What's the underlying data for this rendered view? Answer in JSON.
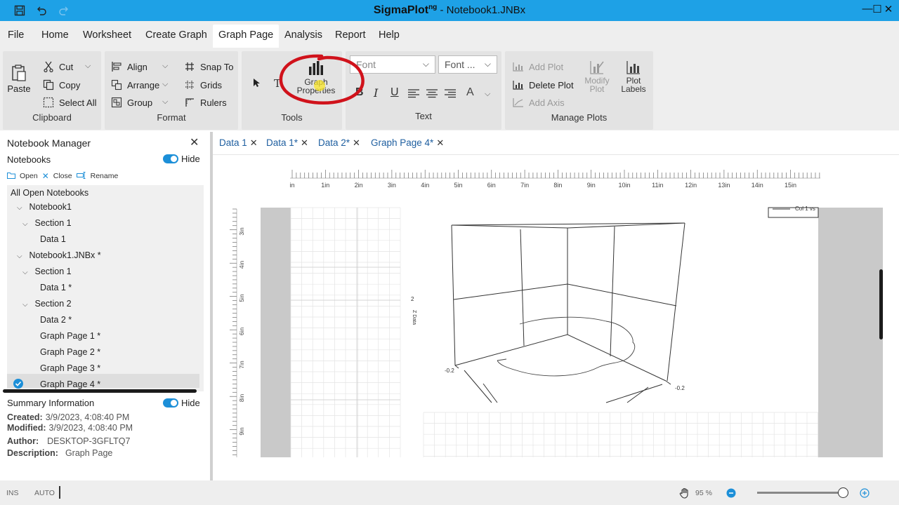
{
  "window": {
    "app_name": "SigmaPlot",
    "app_superscript": "ng",
    "doc_title": " - Notebook1.JNBx",
    "controls": [
      "—",
      "☐",
      "✕"
    ]
  },
  "menu": {
    "items": [
      "File",
      "Home",
      "Worksheet",
      "Create Graph",
      "Graph Page",
      "Analysis",
      "Report",
      "Help"
    ],
    "active": "Graph Page"
  },
  "ribbon": {
    "clipboard": {
      "label": "Clipboard",
      "paste": "Paste",
      "cut": "Cut",
      "copy": "Copy",
      "select_all": "Select All"
    },
    "format": {
      "label": "Format",
      "align": "Align",
      "arrange": "Arrange",
      "group": "Group",
      "snap_to": "Snap To",
      "grids": "Grids",
      "rulers": "Rulers"
    },
    "tools": {
      "label": "Tools",
      "text_tool": "T",
      "graph_properties_line1": "Graph",
      "graph_properties_line2": "Properties"
    },
    "text": {
      "label": "Text",
      "font_placeholder": "Font",
      "font_size_placeholder": "Font ...",
      "bold": "B",
      "italic": "I",
      "underline": "U",
      "color": "A"
    },
    "manage_plots": {
      "label": "Manage Plots",
      "add_plot": "Add Plot",
      "delete_plot": "Delete Plot",
      "add_axis": "Add Axis",
      "modify_plot_line1": "Modify",
      "modify_plot_line2": "Plot",
      "plot_labels_line1": "Plot",
      "plot_labels_line2": "Labels"
    }
  },
  "notebook_manager": {
    "title": "Notebook Manager",
    "notebooks_label": "Notebooks",
    "hide_label": "Hide",
    "tools": {
      "open": "Open",
      "close": "Close",
      "rename": "Rename"
    },
    "tree": [
      {
        "label": "All Open Notebooks",
        "level": 0,
        "twisty": ""
      },
      {
        "label": "Notebook1",
        "level": 1,
        "twisty": "⌵"
      },
      {
        "label": "Section 1",
        "level": 2,
        "twisty": "⌵"
      },
      {
        "label": "Data 1",
        "level": 3,
        "twisty": ""
      },
      {
        "label": "Notebook1.JNBx *",
        "level": 1,
        "twisty": "⌵"
      },
      {
        "label": "Section 1",
        "level": 2,
        "twisty": "⌵"
      },
      {
        "label": "Data 1 *",
        "level": 3,
        "twisty": ""
      },
      {
        "label": "Section 2",
        "level": 2,
        "twisty": "⌵"
      },
      {
        "label": "Data 2 *",
        "level": 3,
        "twisty": ""
      },
      {
        "label": "Graph Page 1 *",
        "level": 3,
        "twisty": ""
      },
      {
        "label": "Graph Page 2 *",
        "level": 3,
        "twisty": ""
      },
      {
        "label": "Graph Page 3 *",
        "level": 3,
        "twisty": ""
      },
      {
        "label": "Graph Page 4 *",
        "level": 3,
        "twisty": ""
      }
    ],
    "selected_index": 12,
    "summary": {
      "title": "Summary Information",
      "hide_label": "Hide",
      "created_label": "Created:",
      "created": "3/9/2023, 4:08:40 PM",
      "modified_label": "Modified:",
      "modified": "3/9/2023, 4:08:40 PM",
      "author_label": "Author:",
      "author": "DESKTOP-3GFLTQ7",
      "description_label": "Description:",
      "description": "Graph Page"
    }
  },
  "doc_tabs": {
    "tabs": [
      "Data 1",
      "Data 1*",
      "Data 2*",
      "Graph Page 4*"
    ],
    "active_index": 3
  },
  "graph_page": {
    "h_ruler": [
      "in",
      "1in",
      "2in",
      "3in",
      "4in",
      "5in",
      "6in",
      "7in",
      "8in",
      "9in",
      "10in",
      "11in",
      "12in",
      "13in",
      "14in",
      "15in"
    ],
    "v_ruler": [
      "3in",
      "4in",
      "5in",
      "6in",
      "7in",
      "8in",
      "9in"
    ],
    "z_axis_title": "Z Data",
    "z_tick": "2",
    "x_tick": "-0.2",
    "y_tick": "-0.2",
    "legend_text": "Col 1 vs"
  },
  "status": {
    "ins": "INS",
    "auto": "AUTO",
    "zoom": "95 %",
    "zoom_level": 0.95
  },
  "colors": {
    "title_bar": "#1ea1e6",
    "accent": "#1c8fd8",
    "annotation_circle": "#d0121b"
  }
}
